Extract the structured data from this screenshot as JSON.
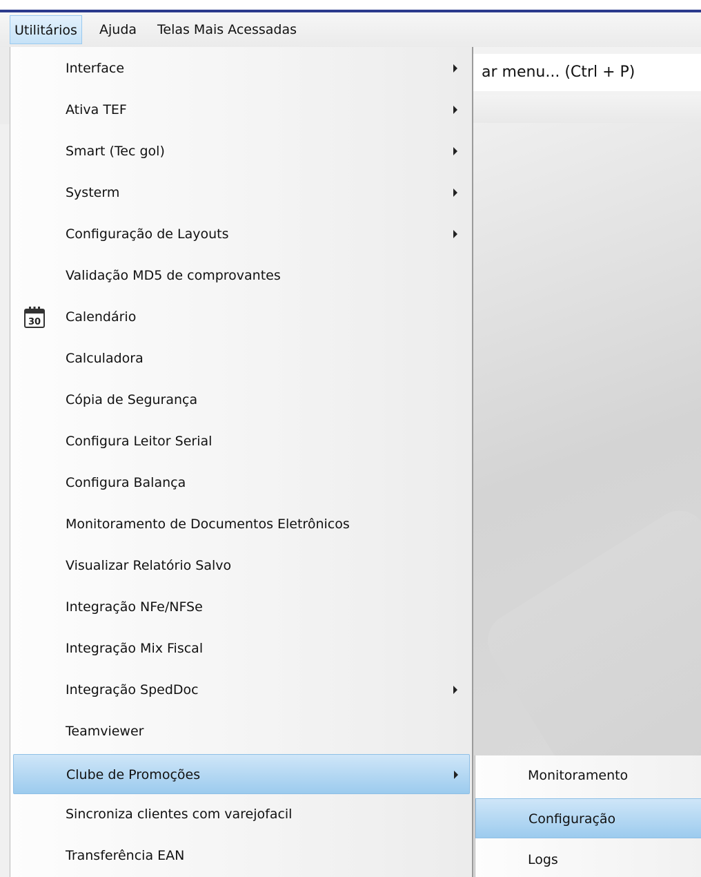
{
  "menubar": {
    "items": [
      "Utilitários",
      "Ajuda",
      "Telas Mais Acessadas"
    ]
  },
  "search": {
    "value": "ar menu... (Ctrl + P)"
  },
  "dropdown": {
    "items": [
      {
        "label": "Interface",
        "submenu": true
      },
      {
        "label": "Ativa TEF",
        "submenu": true
      },
      {
        "label": "Smart (Tec gol)",
        "submenu": true
      },
      {
        "label": "Systerm",
        "submenu": true
      },
      {
        "label": "Configuração de Layouts",
        "submenu": true
      },
      {
        "label": "Validação MD5 de comprovantes",
        "submenu": false
      },
      {
        "label": "Calendário",
        "submenu": false,
        "icon": "calendar-icon",
        "icon_text": "30"
      },
      {
        "label": "Calculadora",
        "submenu": false
      },
      {
        "label": "Cópia de Segurança",
        "submenu": false
      },
      {
        "label": "Configura Leitor Serial",
        "submenu": false
      },
      {
        "label": "Configura Balança",
        "submenu": false
      },
      {
        "label": "Monitoramento de Documentos Eletrônicos",
        "submenu": false
      },
      {
        "label": "Visualizar Relatório Salvo",
        "submenu": false
      },
      {
        "label": "Integração NFe/NFSe",
        "submenu": false
      },
      {
        "label": "Integração Mix Fiscal",
        "submenu": false
      },
      {
        "label": "Integração SpedDoc",
        "submenu": true
      },
      {
        "label": "Teamviewer",
        "submenu": false
      },
      {
        "label": "Clube de Promoções",
        "submenu": true,
        "highlighted": true
      },
      {
        "label": "Sincroniza clientes com varejofacil",
        "submenu": false
      },
      {
        "label": "Transferência EAN",
        "submenu": false
      }
    ]
  },
  "submenu": {
    "items": [
      {
        "label": "Monitoramento"
      },
      {
        "label": "Configuração",
        "highlighted": true
      },
      {
        "label": "Logs"
      }
    ]
  },
  "colors": {
    "accent_line": "#2b3a8c",
    "highlight": "#9ccbee"
  }
}
